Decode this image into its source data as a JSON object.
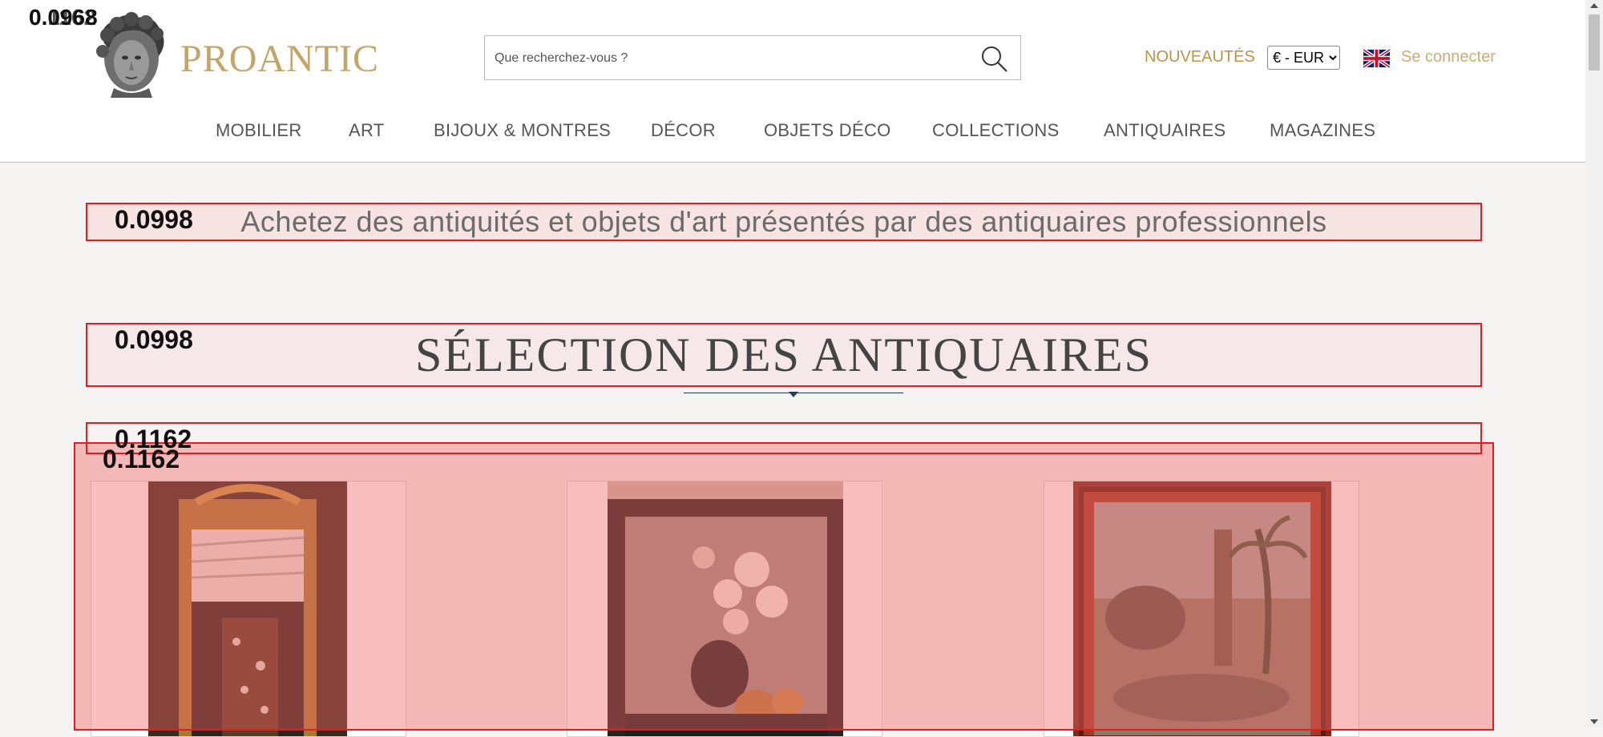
{
  "header": {
    "logo_text": "PROANTIC",
    "search_placeholder": "Que recherchez-vous ?",
    "nouveautes": "NOUVEAUTÉS",
    "currency_selected": "€ - EUR",
    "login": "Se connecter"
  },
  "nav": [
    "MOBILIER",
    "ART",
    "BIJOUX & MONTRES",
    "DÉCOR",
    "OBJETS DÉCO",
    "COLLECTIONS",
    "ANTIQUAIRES",
    "MAGAZINES"
  ],
  "main": {
    "tagline": "Achetez des antiquités et objets d'art présentés par des antiquaires professionnels",
    "section_title": "SÉLECTION DES ANTIQUAIRES"
  },
  "scores": {
    "logo_a": "0.0968",
    "logo_b": "0.1162",
    "tagline": "0.0998",
    "section_title": "0.0998",
    "grid_a": "0.1162",
    "grid_b": "0.1162"
  },
  "colors": {
    "brand_gold": "#c2a56a",
    "highlight_red": "#e41b23",
    "nav_text": "#555555"
  }
}
